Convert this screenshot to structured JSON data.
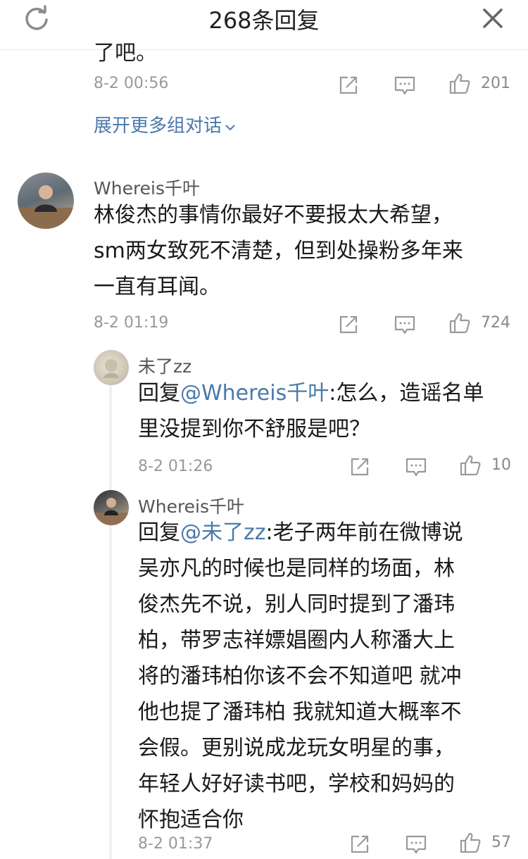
{
  "header": {
    "title": "268条回复",
    "refresh_icon": "refresh-icon",
    "close_icon": "close-icon"
  },
  "partial_comment": {
    "text_cut": "了吧。",
    "time": "8-2 00:56",
    "likes": "201"
  },
  "expand_link": {
    "label": "展开更多组对话",
    "icon": "chevron-down-icon"
  },
  "comments": [
    {
      "user": "Whereis千叶",
      "lines": [
        "林俊杰的事情你最好不要报太大希望，",
        "sm两女致死不清楚，但到处操粉多年来",
        "一直有耳闻。"
      ],
      "time": "8-2 01:19",
      "likes": "724"
    },
    {
      "user": "未了zz",
      "reply_prefix": "回复",
      "mention": "@Whereis千叶",
      "lines": [
        ":怎么，造谣名单",
        "里没提到你不舒服是吧？"
      ],
      "time": "8-2 01:26",
      "likes": "10"
    },
    {
      "user": "Whereis千叶",
      "reply_prefix": "回复",
      "mention": "@未了zz",
      "lines": [
        ":老子两年前在微博说",
        "吴亦凡的时候也是同样的场面，林",
        "俊杰先不说，别人同时提到了潘玮",
        "柏，带罗志祥嫖娼圈内人称潘大上",
        "将的潘玮柏你该不会不知道吧 就冲",
        "他也提了潘玮柏 我就知道大概率不",
        "会假。更别说成龙玩女明星的事，",
        "年轻人好好读书吧，学校和妈妈的",
        "怀抱适合你"
      ],
      "time": "8-2 01:37",
      "likes": "57"
    }
  ],
  "icons": {
    "share": "share-icon",
    "reply": "comment-icon",
    "like": "thumbs-up-icon"
  },
  "colors": {
    "link": "#4a7aaa",
    "meta": "#999999",
    "text": "#1a1a1a"
  }
}
